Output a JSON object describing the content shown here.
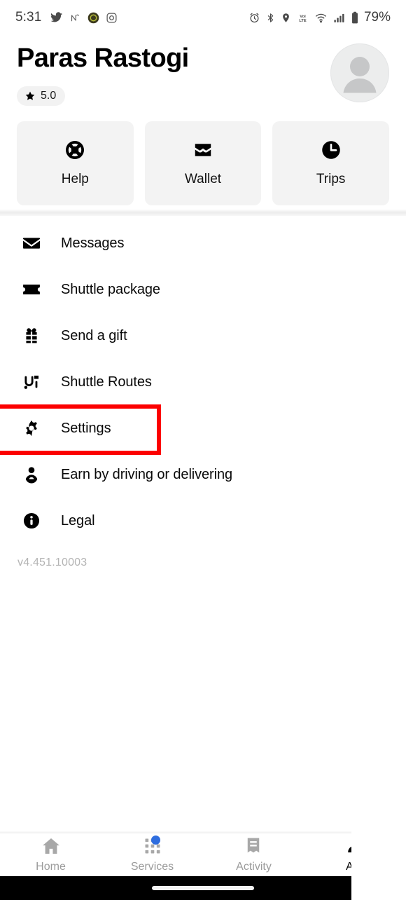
{
  "status_bar": {
    "time": "5:31",
    "battery_percent": "79%",
    "left_icons": [
      "twitter-icon",
      "news-n-icon",
      "olive-circle-app-icon",
      "instagram-icon"
    ],
    "right_icons": [
      "alarm-icon",
      "bluetooth-icon",
      "location-icon",
      "volte-icon",
      "wifi-icon",
      "signal-bars-icon",
      "battery-icon"
    ]
  },
  "header": {
    "name": "Paras Rastogi",
    "rating": "5.0",
    "rating_icon": "star-icon",
    "avatar_icon": "person-avatar-icon"
  },
  "quick_actions": [
    {
      "label": "Help",
      "icon": "lifebuoy-icon"
    },
    {
      "label": "Wallet",
      "icon": "wallet-icon"
    },
    {
      "label": "Trips",
      "icon": "clock-icon"
    }
  ],
  "menu": [
    {
      "label": "Messages",
      "icon": "envelope-icon",
      "highlighted": false
    },
    {
      "label": "Shuttle package",
      "icon": "ticket-icon",
      "highlighted": false
    },
    {
      "label": "Send a gift",
      "icon": "gift-icon",
      "highlighted": false
    },
    {
      "label": "Shuttle Routes",
      "icon": "route-icon",
      "highlighted": false
    },
    {
      "label": "Settings",
      "icon": "gear-icon",
      "highlighted": true
    },
    {
      "label": "Earn by driving or delivering",
      "icon": "person-icon",
      "highlighted": false
    },
    {
      "label": "Legal",
      "icon": "info-icon",
      "highlighted": false
    }
  ],
  "version": "v4.451.10003",
  "bottom_nav": [
    {
      "label": "Home",
      "icon": "home-icon",
      "active": false,
      "badge": false
    },
    {
      "label": "Services",
      "icon": "grid-icon",
      "active": false,
      "badge": true
    },
    {
      "label": "Activity",
      "icon": "receipt-icon",
      "active": false,
      "badge": false
    },
    {
      "label": "Acc",
      "icon": "account-icon",
      "active": true,
      "badge": false
    }
  ],
  "colors": {
    "highlight_box": "#fc0000",
    "badge_blue": "#2e6ddf",
    "card_bg": "#f3f3f3",
    "text_primary": "#090909",
    "text_muted": "#9b9b9b"
  }
}
